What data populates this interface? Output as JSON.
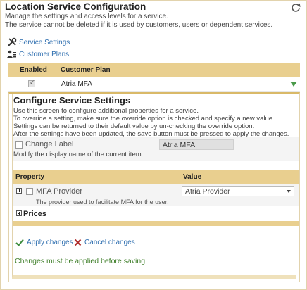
{
  "header": {
    "title": "Location Service Configuration",
    "description_line1": "Manage the settings and access levels for a service.",
    "description_line2": "The service cannot be deleted if it is used by customers, users or dependent services."
  },
  "links": {
    "service_settings": "Service Settings",
    "customer_plans": "Customer Plans"
  },
  "plan_table": {
    "columns": [
      "Enabled",
      "Customer Plan"
    ],
    "rows": [
      {
        "enabled": true,
        "plan": "Atria MFA"
      }
    ]
  },
  "configure": {
    "title": "Configure Service Settings",
    "instructions": [
      "Use this screen to configure additional properties for a service.",
      "To override a setting, make sure the override option is checked and specify a new value.",
      "Settings can be returned to their default value by un-checking the override option.",
      "After the settings have been updated, the save button must be pressed to apply the changes."
    ],
    "change_label": {
      "label": "Change Label",
      "description": "Modify the display name of the current item.",
      "value": "Atria MFA"
    },
    "properties_table": {
      "columns": [
        "Property",
        "Value"
      ],
      "rows": [
        {
          "name": "MFA Provider",
          "description": "The provider used to facilitate MFA for the user.",
          "value": "Atria Provider"
        }
      ]
    },
    "prices_label": "Prices"
  },
  "actions": {
    "apply": "Apply changes",
    "cancel": "Cancel changes"
  },
  "status_message": "Changes must be applied before saving",
  "colors": {
    "accent_tan": "#e9cf8f",
    "link_blue": "#2f6fb0",
    "success_green": "#3f7f2a",
    "cancel_red": "#b03030"
  }
}
